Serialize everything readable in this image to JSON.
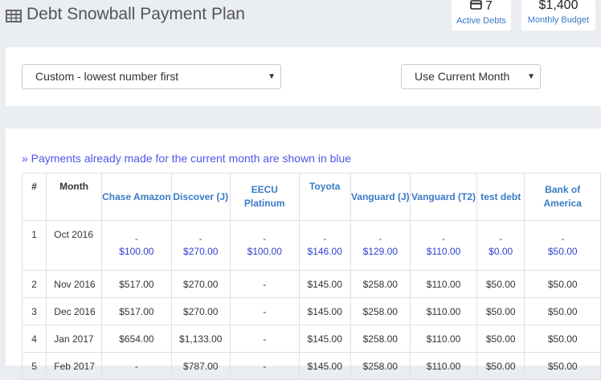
{
  "header": {
    "title": "Debt Snowball Payment Plan",
    "stats": [
      {
        "value": "7",
        "label": "Active Debts"
      },
      {
        "value": "$1,400",
        "label": "Monthly Budget"
      }
    ]
  },
  "controls": {
    "strategy_value": "Custom - lowest number first",
    "month_value": "Use Current Month"
  },
  "note": "» Payments already made for the current month are shown in blue",
  "table": {
    "headers": [
      "#",
      "Month",
      "Chase Amazon",
      "Discover (J)",
      "EECU Platinum",
      "Toyota",
      "Vanguard (J)",
      "Vanguard (T2)",
      "test debt",
      "Bank of America"
    ],
    "first_row": {
      "num": "1",
      "month": "Oct 2016",
      "dash": "-",
      "paid": [
        "$100.00",
        "$270.00",
        "$100.00",
        "$146.00",
        "$129.00",
        "$110.00",
        "$0.00",
        "$50.00"
      ]
    },
    "rows": [
      [
        "2",
        "Nov 2016",
        "$517.00",
        "$270.00",
        "-",
        "$145.00",
        "$258.00",
        "$110.00",
        "$50.00",
        "$50.00"
      ],
      [
        "3",
        "Dec 2016",
        "$517.00",
        "$270.00",
        "-",
        "$145.00",
        "$258.00",
        "$110.00",
        "$50.00",
        "$50.00"
      ],
      [
        "4",
        "Jan 2017",
        "$654.00",
        "$1,133.00",
        "-",
        "$145.00",
        "$258.00",
        "$110.00",
        "$50.00",
        "$50.00"
      ],
      [
        "5",
        "Feb 2017",
        "-",
        "$787.00",
        "-",
        "$145.00",
        "$258.00",
        "$110.00",
        "$50.00",
        "$50.00"
      ]
    ]
  },
  "colors": {
    "accent": "#3a7bc8",
    "paid_blue": "#2f3fcf",
    "note_blue": "#5256e8"
  }
}
